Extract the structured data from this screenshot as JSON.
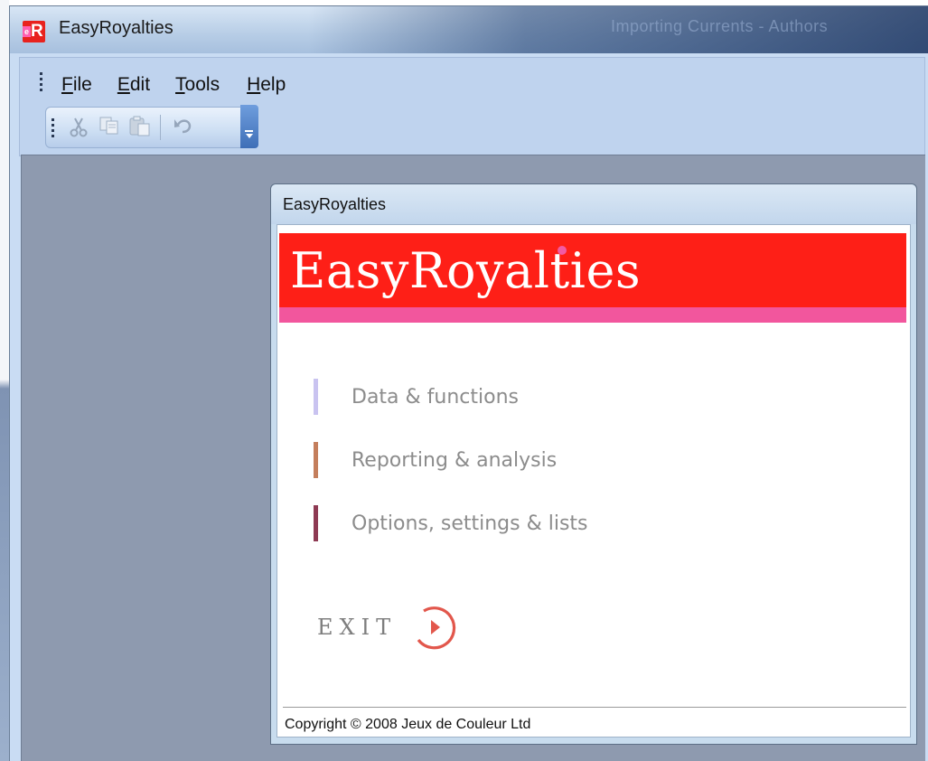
{
  "window": {
    "title": "EasyRoyalties",
    "icon": "easyroyalties-app-icon",
    "icon_letters": "eR",
    "background_title_text": "Importing Currents - Authors"
  },
  "menu": [
    {
      "label": "File",
      "mnemonic": "F"
    },
    {
      "label": "Edit",
      "mnemonic": "E"
    },
    {
      "label": "Tools",
      "mnemonic": "T"
    },
    {
      "label": "Help",
      "mnemonic": "H"
    }
  ],
  "toolbar": {
    "buttons": [
      {
        "name": "cut",
        "icon": "scissors-icon",
        "enabled": false
      },
      {
        "name": "copy",
        "icon": "copy-icon",
        "enabled": false
      },
      {
        "name": "paste",
        "icon": "paste-icon",
        "enabled": false
      },
      {
        "name": "undo",
        "icon": "undo-icon",
        "enabled": false
      }
    ]
  },
  "dialog": {
    "title": "EasyRoyalties",
    "banner_title": "EasyRoyalties",
    "banner_color": "#fe1f17",
    "banner_strip_color": "#f2569d",
    "nav": [
      {
        "label": "Data & functions",
        "accent": "#c9c3f0"
      },
      {
        "label": "Reporting & analysis",
        "accent": "#c47e5c"
      },
      {
        "label": "Options, settings & lists",
        "accent": "#8e3a53"
      }
    ],
    "exit_label": "EXIT",
    "exit_color": "#e2574c",
    "copyright": "Copyright © 2008 Jeux de Couleur Ltd"
  }
}
